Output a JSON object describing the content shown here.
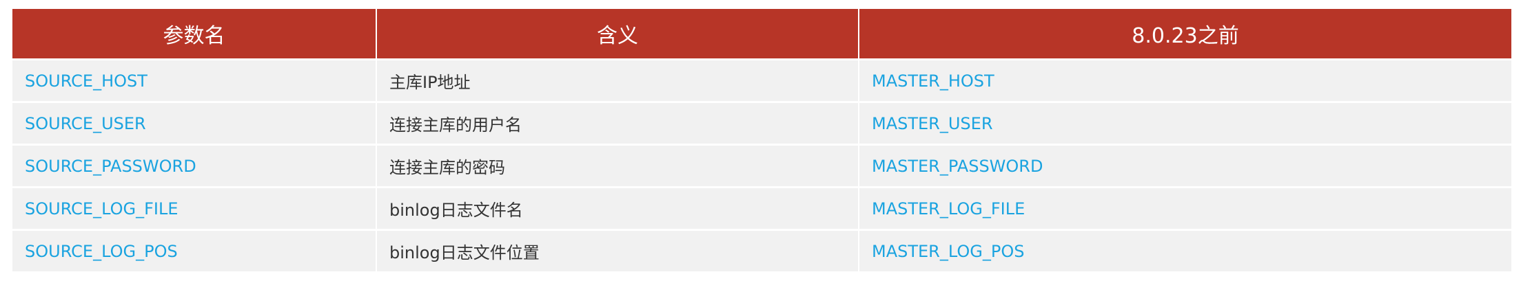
{
  "table": {
    "headers": [
      "参数名",
      "含义",
      "8.0.23之前"
    ],
    "rows": [
      {
        "param": "SOURCE_HOST",
        "meaning": "主库IP地址",
        "legacy": "MASTER_HOST"
      },
      {
        "param": "SOURCE_USER",
        "meaning": "连接主库的用户名",
        "legacy": "MASTER_USER"
      },
      {
        "param": "SOURCE_PASSWORD",
        "meaning": "连接主库的密码",
        "legacy": "MASTER_PASSWORD"
      },
      {
        "param": "SOURCE_LOG_FILE",
        "meaning": "binlog日志文件名",
        "legacy": "MASTER_LOG_FILE"
      },
      {
        "param": "SOURCE_LOG_POS",
        "meaning": "binlog日志文件位置",
        "legacy": "MASTER_LOG_POS"
      }
    ]
  },
  "colors": {
    "header_bg": "#b73527",
    "header_text": "#ffffff",
    "row_bg": "#f1f1f1",
    "param_text": "#1aa3e0",
    "meaning_text": "#333333"
  }
}
